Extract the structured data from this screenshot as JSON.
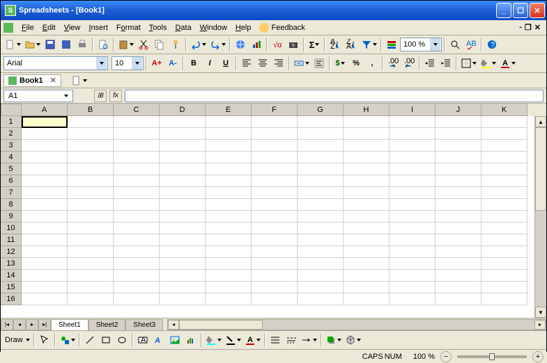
{
  "title": "Spreadsheets - [Book1]",
  "menu": {
    "file": "File",
    "edit": "Edit",
    "view": "View",
    "insert": "Insert",
    "format": "Format",
    "tools": "Tools",
    "data": "Data",
    "window": "Window",
    "help": "Help",
    "feedback": "Feedback"
  },
  "tabs": {
    "book": "Book1"
  },
  "font": {
    "name": "Arial",
    "size": "10"
  },
  "zoom": "100 %",
  "cell_ref": "A1",
  "sheets": [
    "Sheet1",
    "Sheet2",
    "Sheet3"
  ],
  "columns": [
    "A",
    "B",
    "C",
    "D",
    "E",
    "F",
    "G",
    "H",
    "I",
    "J",
    "K"
  ],
  "rows": [
    "1",
    "2",
    "3",
    "4",
    "5",
    "6",
    "7",
    "8",
    "9",
    "10",
    "11",
    "12",
    "13",
    "14",
    "15",
    "16"
  ],
  "status": {
    "caps": "CAPS",
    "num": "NUM",
    "zoom": "100 %"
  },
  "draw_label": "Draw",
  "bold": "B",
  "italic": "I",
  "underline": "U",
  "currency": "$",
  "percent": "%",
  "comma": ","
}
